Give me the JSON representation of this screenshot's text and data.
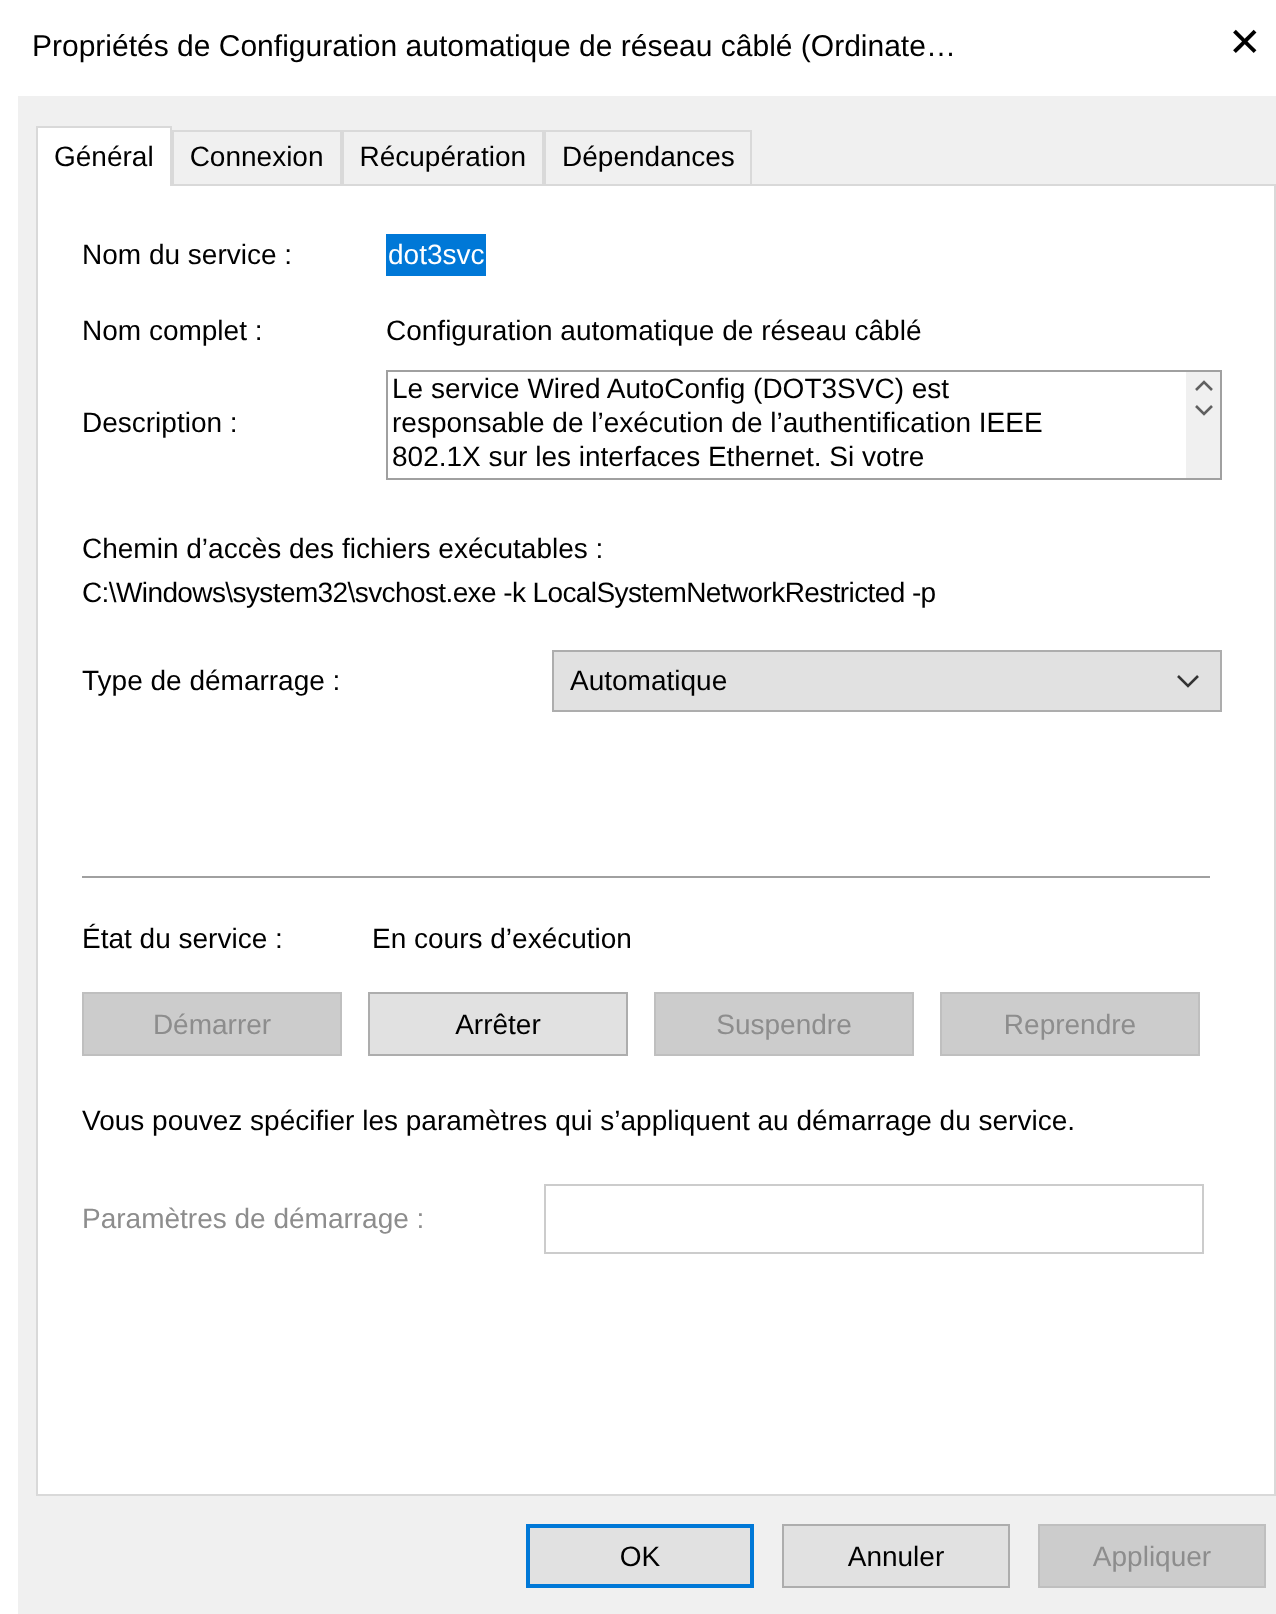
{
  "window": {
    "title": "Propriétés de Configuration automatique de réseau câblé (Ordinate…",
    "close": "✕"
  },
  "tabs": [
    {
      "label": "Général",
      "selected": true
    },
    {
      "label": "Connexion",
      "selected": false
    },
    {
      "label": "Récupération",
      "selected": false
    },
    {
      "label": "Dépendances",
      "selected": false
    }
  ],
  "service_name": {
    "label": "Nom du service :",
    "value": "dot3svc",
    "selected": true
  },
  "display_name": {
    "label": "Nom complet :",
    "value": "Configuration automatique de réseau câblé"
  },
  "description": {
    "label": "Description :",
    "value": "Le service Wired AutoConfig (DOT3SVC) est responsable de l’exécution de l’authentification IEEE 802.1X sur les interfaces Ethernet. Si votre"
  },
  "executable_path": {
    "label": "Chemin d’accès des fichiers exécutables :",
    "value": "C:\\Windows\\system32\\svchost.exe -k LocalSystemNetworkRestricted -p"
  },
  "startup_type": {
    "label": "Type de démarrage :",
    "value": "Automatique"
  },
  "service_status": {
    "label": "État du service :",
    "value": "En cours d’exécution"
  },
  "service_buttons": [
    {
      "label": "Démarrer",
      "disabled": true
    },
    {
      "label": "Arrêter",
      "disabled": false
    },
    {
      "label": "Suspendre",
      "disabled": true
    },
    {
      "label": "Reprendre",
      "disabled": true
    }
  ],
  "help_text": "Vous pouvez spécifier les paramètres qui s’appliquent au démarrage du service.",
  "start_parameters": {
    "label": "Paramètres de démarrage :",
    "disabled": true
  },
  "dialog_buttons": [
    {
      "label": "OK",
      "disabled": false,
      "default": true
    },
    {
      "label": "Annuler",
      "disabled": false,
      "default": false
    },
    {
      "label": "Appliquer",
      "disabled": true,
      "default": false
    }
  ]
}
